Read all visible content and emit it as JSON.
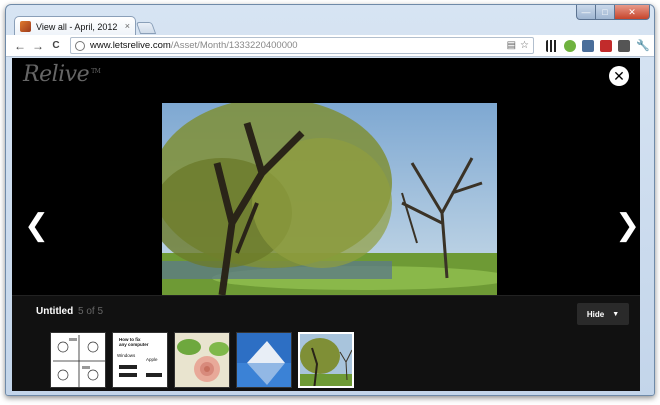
{
  "browser": {
    "tab_title": "View all - April, 2012",
    "tab_close": "×",
    "url_host": "www.letsrelive.com",
    "url_path": "/Asset/Month/1333220400000",
    "back": "←",
    "forward": "→",
    "reload": "C",
    "minimize": "—",
    "maximize": "□",
    "close": "✕",
    "star": "☆"
  },
  "viewer": {
    "logo": "Relive",
    "logo_tm": "TM",
    "close_glyph": "✕",
    "prev_glyph": "❮",
    "next_glyph": "❯",
    "photo_title": "Untitled",
    "counter": "5 of 5",
    "hide_label": "Hide",
    "hide_caret": "▼",
    "selected_index": 4
  },
  "thumbnails": [
    {
      "name": "comic-drawing"
    },
    {
      "name": "how-to-fix-computer-flowchart",
      "text_line1": "How to fix",
      "text_line2": "any computer",
      "text_win": "Windows",
      "text_apple": "Apple"
    },
    {
      "name": "pink-rose"
    },
    {
      "name": "mountain-lake"
    },
    {
      "name": "willow-tree"
    }
  ],
  "colors": {
    "viewer_bg": "#000000",
    "info_bar_bg": "#111111",
    "hide_btn_bg": "#2a2a2a"
  }
}
